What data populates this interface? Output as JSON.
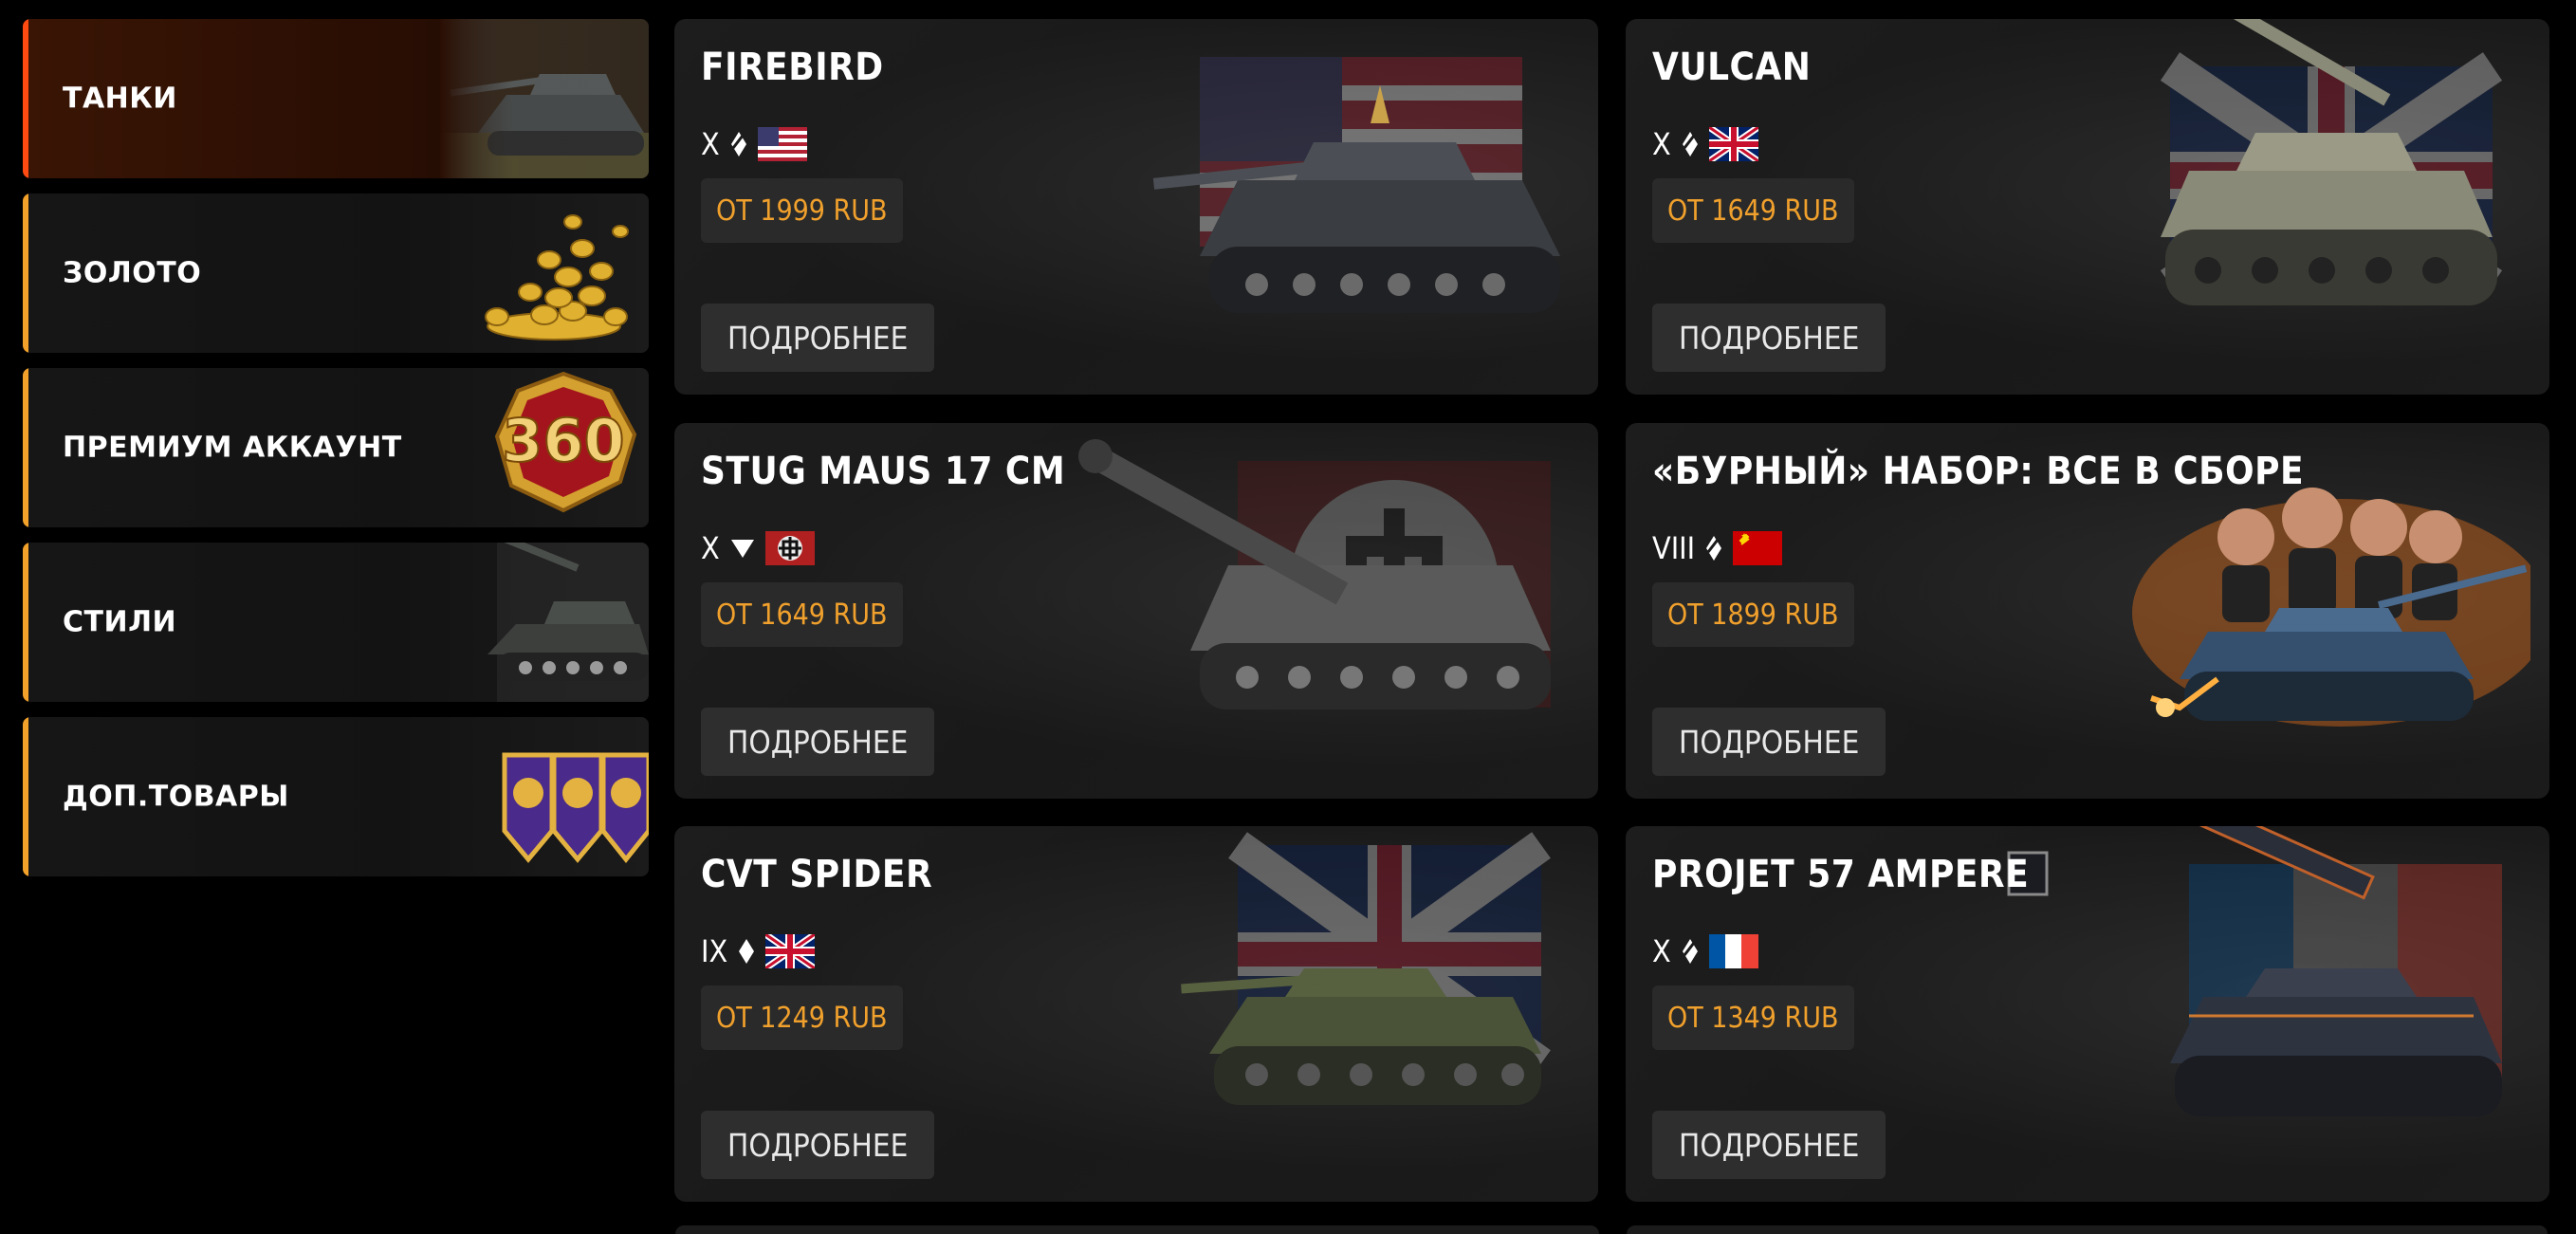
{
  "sidebar": {
    "items": [
      {
        "label": "ТАНКИ",
        "active": true,
        "thumb": "tank-thumb"
      },
      {
        "label": "ЗОЛОТО",
        "active": false,
        "thumb": "gold-coins-thumb"
      },
      {
        "label": "ПРЕМИУМ АККАУНТ",
        "active": false,
        "thumb": "premium-360-badge"
      },
      {
        "label": "СТИЛИ",
        "active": false,
        "thumb": "styled-tank-thumb"
      },
      {
        "label": "ДОП.ТОВАРЫ",
        "active": false,
        "thumb": "badges-thumb"
      }
    ]
  },
  "cards": [
    {
      "title": "FIREBIRD",
      "tier": "X",
      "class_icon": "heavy-icon",
      "nation": "usa-flag",
      "price": "ОТ 1999 RUB",
      "button": "ПОДРОБНЕЕ"
    },
    {
      "title": "VULCAN",
      "tier": "X",
      "class_icon": "heavy-icon",
      "nation": "uk-flag",
      "price": "ОТ 1649 RUB",
      "button": "ПОДРОБНЕЕ"
    },
    {
      "title": "STUG MAUS 17 CM",
      "tier": "X",
      "class_icon": "td-icon",
      "nation": "germany-flag",
      "price": "ОТ 1649 RUB",
      "button": "ПОДРОБНЕЕ"
    },
    {
      "title": "«БУРНЫЙ» НАБОР: ВСЕ В СБОРЕ",
      "tier": "VIII",
      "class_icon": "heavy-icon",
      "nation": "ussr-flag",
      "price": "ОТ 1899 RUB",
      "button": "ПОДРОБНЕЕ"
    },
    {
      "title": "CVT SPIDER",
      "tier": "IX",
      "class_icon": "light-icon",
      "nation": "uk-flag",
      "price": "ОТ 1249 RUB",
      "button": "ПОДРОБНЕЕ"
    },
    {
      "title": "PROJET 57 AMPERE",
      "tier": "X",
      "class_icon": "heavy-icon",
      "nation": "france-flag",
      "price": "ОТ 1349 RUB",
      "button": "ПОДРОБНЕЕ"
    }
  ],
  "colors": {
    "accent": "#f2a12a",
    "active_accent": "#ff4a12",
    "price": "#f0a02c"
  }
}
